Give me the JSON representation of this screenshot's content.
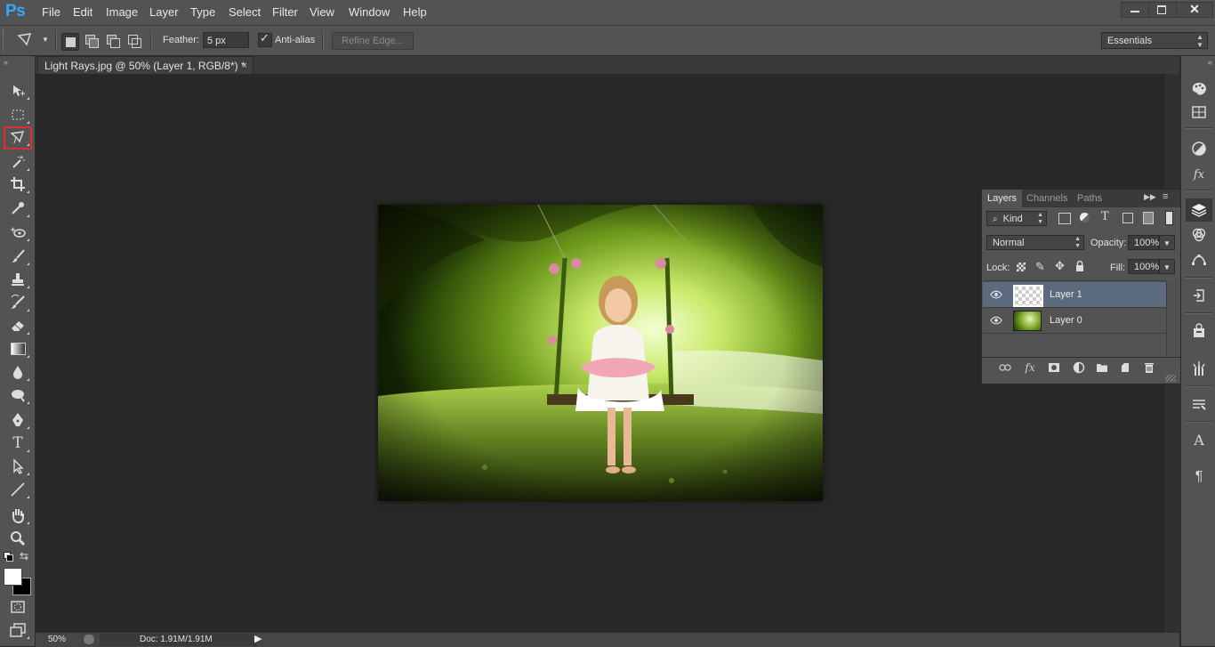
{
  "app": {
    "logo": "Ps"
  },
  "menu": [
    "File",
    "Edit",
    "Image",
    "Layer",
    "Type",
    "Select",
    "Filter",
    "View",
    "Window",
    "Help"
  ],
  "options": {
    "feather_label": "Feather:",
    "feather_value": "5 px",
    "antialias_label": "Anti-alias",
    "antialias_checked": true,
    "refine_edge_label": "Refine Edge...",
    "workspace": "Essentials"
  },
  "document": {
    "tab_title": "Light Rays.jpg @ 50% (Layer 1, RGB/8*) *",
    "close_glyph": "×"
  },
  "status": {
    "zoom": "50%",
    "doc_info": "Doc: 1.91M/1.91M"
  },
  "layers_panel": {
    "tabs": [
      "Layers",
      "Channels",
      "Paths"
    ],
    "active_tab": "Layers",
    "filter_kind": "Kind",
    "blend_mode": "Normal",
    "opacity_label": "Opacity:",
    "opacity_value": "100%",
    "lock_label": "Lock:",
    "fill_label": "Fill:",
    "fill_value": "100%",
    "layers": [
      {
        "name": "Layer 1",
        "selected": true
      },
      {
        "name": "Layer 0",
        "selected": false
      }
    ],
    "fx_label": "fx"
  },
  "colors": {
    "ui_bg": "#535353",
    "canvas_bg": "#282828",
    "accent_logo": "#31a8ff",
    "selected_layer": "#5b6a7c",
    "active_tool_outline": "#d9302f",
    "foreground_color": "#ffffff",
    "background_color": "#000000"
  },
  "icons": {
    "toolbar": [
      "move-icon",
      "rectangular-marquee-icon",
      "polygonal-lasso-icon",
      "magic-wand-icon",
      "crop-icon",
      "eyedropper-icon",
      "spot-healing-icon",
      "brush-icon",
      "clone-stamp-icon",
      "history-brush-icon",
      "eraser-icon",
      "gradient-icon",
      "blur-icon",
      "dodge-icon",
      "pen-icon",
      "type-icon",
      "path-selection-icon",
      "line-icon",
      "hand-icon",
      "zoom-icon",
      "swap-colors-icon",
      "quick-mask-icon",
      "screen-mode-icon"
    ],
    "dock": [
      "color-icon",
      "swatches-icon",
      "adjustments-icon",
      "styles-icon",
      "layers-icon",
      "channels-icon",
      "paths-icon",
      "history-icon",
      "properties-icon",
      "tool-presets-icon",
      "paragraph-style-icon",
      "character-icon",
      "paragraph-icon"
    ]
  }
}
